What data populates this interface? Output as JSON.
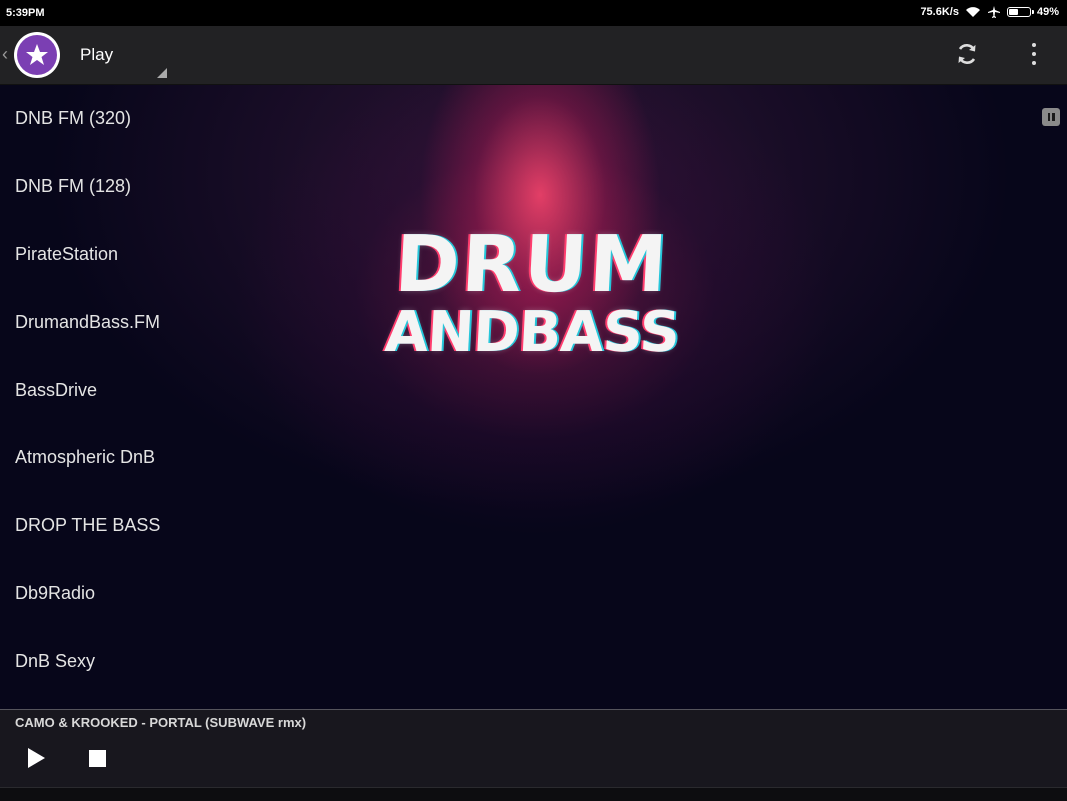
{
  "status_bar": {
    "time": "5:39PM",
    "network_speed": "75.6K/s",
    "battery_percent_text": "49%",
    "battery_level": 0.49,
    "icons": [
      "wifi-icon",
      "airplane-icon",
      "battery-icon"
    ]
  },
  "action_bar": {
    "title": "Play",
    "icons": [
      "back-chevron-icon",
      "app-logo-icon",
      "refresh-icon",
      "overflow-menu-icon"
    ]
  },
  "artwork": {
    "line1": "DRUM",
    "line2": "ANDBASS"
  },
  "stations": [
    {
      "label": "DNB FM (320)"
    },
    {
      "label": "DNB FM (128)"
    },
    {
      "label": "PirateStation"
    },
    {
      "label": "DrumandBass.FM"
    },
    {
      "label": "BassDrive"
    },
    {
      "label": "Atmospheric DnB"
    },
    {
      "label": "DROP THE BASS"
    },
    {
      "label": "Db9Radio"
    },
    {
      "label": "DnB Sexy"
    }
  ],
  "player": {
    "now_playing": "CAMO & KROOKED - PORTAL (SUBWAVE rmx)",
    "controls": [
      "play-icon",
      "stop-icon"
    ]
  },
  "colors": {
    "accent_purple": "#7b3fb3",
    "glow_pink": "#ff466e",
    "background": "#07061a",
    "action_bar": "#222224"
  }
}
